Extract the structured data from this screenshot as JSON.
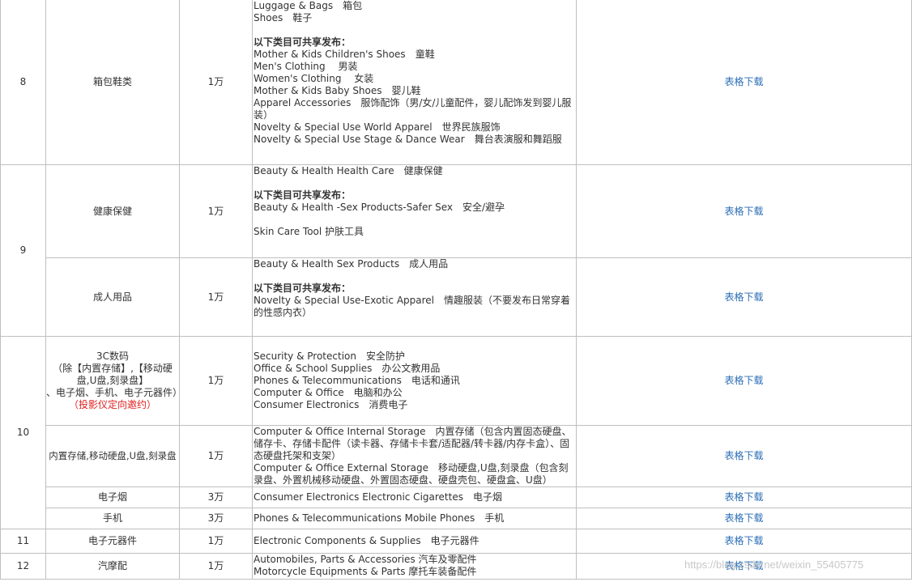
{
  "rows": {
    "r8": {
      "num": "8",
      "category": "箱包鞋类",
      "deposit": "1万",
      "download": "表格下载",
      "lines_a": [
        "Luggage & Bags　箱包",
        "Shoes　鞋子"
      ],
      "shared_title": "以下类目可共享发布：",
      "lines_b": [
        "Mother & Kids Children's Shoes　童鞋",
        "Men's Clothing　 男装",
        "Women's Clothing　 女装",
        "Mother & Kids Baby Shoes　婴儿鞋"
      ],
      "wrap_line": "Apparel Accessories　服饰配饰（男/女/儿童配件，婴儿配饰发到婴儿服装）",
      "lines_c": [
        "Novelty & Special Use World Apparel　世界民族服饰",
        "Novelty & Special Use Stage & Dance Wear　舞台表演服和舞蹈服"
      ]
    },
    "r9_num": "9",
    "r9a": {
      "category": "健康保健",
      "deposit": "1万",
      "download": "表格下载",
      "line1": "Beauty & Health Health Care　健康保健",
      "shared_title": "以下类目可共享发布：",
      "line2": "Beauty & Health -Sex Products-Safer Sex　安全/避孕",
      "line3": "Skin Care Tool 护肤工具"
    },
    "r9b": {
      "category": "成人用品",
      "deposit": "1万",
      "download": "表格下载",
      "line1": "Beauty & Health Sex Products　成人用品",
      "shared_title": "以下类目可共享发布：",
      "wrap_line": "Novelty & Special Use-Exotic Apparel　情趣服装（不要发布日常穿着的性感内衣）"
    },
    "r10_num": "10",
    "r10a": {
      "cat_l1": "3C数码",
      "cat_l2": "（除【内置存储】,【移动硬盘,U盘,刻录盘】",
      "cat_l3": "、电子烟、手机、电子元器件）",
      "cat_red": "（投影仪定向邀约）",
      "deposit": "1万",
      "download": "表格下载",
      "lines": [
        "Security & Protection　安全防护",
        "Office & School Supplies　办公文教用品",
        "Phones & Telecommunications　电话和通讯",
        "Computer & Office　电脑和办公",
        "Consumer Electronics　消费电子"
      ]
    },
    "r10b": {
      "category": "内置存储,移动硬盘,U盘,刻录盘",
      "deposit": "1万",
      "download": "表格下载",
      "wrap1": "Computer & Office Internal Storage　内置存储（包含内置固态硬盘、储存卡、存储卡配件（读卡器、存储卡卡套/适配器/转卡器/内存卡盒）、固态硬盘托架和支架）",
      "wrap2": "Computer & Office External Storage　移动硬盘,U盘,刻录盘（包含刻录盘、外置机械移动硬盘、外置固态硬盘、硬盘壳包、硬盘盒、U盘）"
    },
    "r10c": {
      "category": "电子烟",
      "deposit": "3万",
      "download": "表格下载",
      "line": "Consumer Electronics Electronic Cigarettes　电子烟"
    },
    "r10d": {
      "category": "手机",
      "deposit": "3万",
      "download": "表格下载",
      "line": "Phones & Telecommunications Mobile Phones　手机"
    },
    "r11": {
      "num": "11",
      "category": "电子元器件",
      "deposit": "1万",
      "download": "表格下载",
      "line": "Electronic Components & Supplies　电子元器件"
    },
    "r12": {
      "num": "12",
      "category": "汽摩配",
      "deposit": "1万",
      "download": "表格下载",
      "line1": "Automobiles, Parts & Accessories 汽车及零配件",
      "line2": "Motorcycle Equipments & Parts 摩托车装备配件"
    }
  },
  "watermark": "https://blog.csdn.net/weixin_55405775",
  "colors": {
    "link": "#2a6db5",
    "notice": "#e02020",
    "border": "#bfbfbf"
  }
}
